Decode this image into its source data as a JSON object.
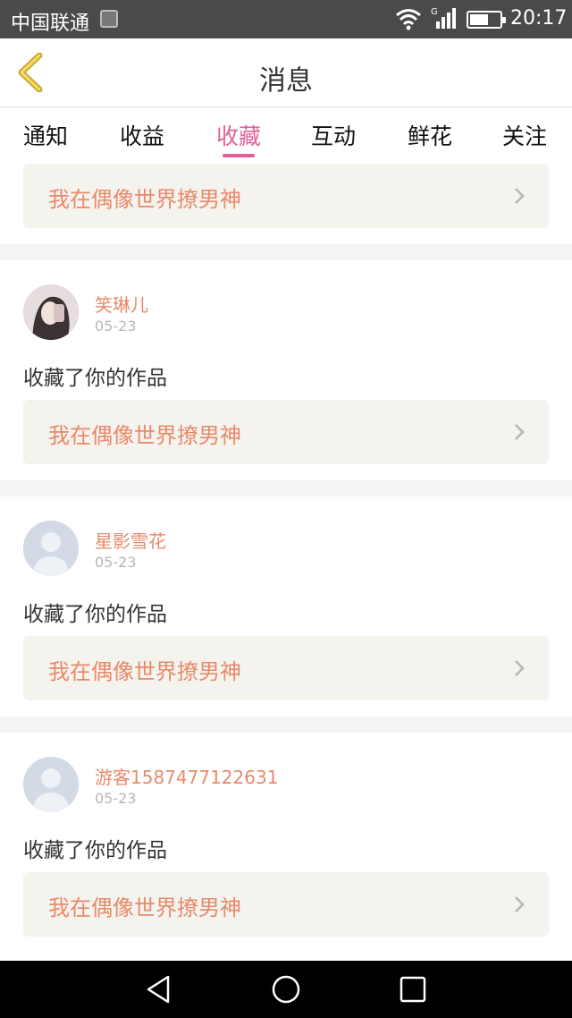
{
  "statusbar": {
    "carrier": "中国联通",
    "time": "20:17",
    "network": "G"
  },
  "header": {
    "title": "消息"
  },
  "tabs": [
    "通知",
    "收益",
    "收藏",
    "互动",
    "鲜花",
    "关注"
  ],
  "active_tab_index": 2,
  "top_link": "我在偶像世界撩男神",
  "items": [
    {
      "username": "笑琳儿",
      "date": "05-23",
      "action": "收藏了你的作品",
      "link": "我在偶像世界撩男神",
      "avatar": "photo"
    },
    {
      "username": "星影雪花",
      "date": "05-23",
      "action": "收藏了你的作品",
      "link": "我在偶像世界撩男神",
      "avatar": "default"
    },
    {
      "username": "游客1587477122631",
      "date": "05-23",
      "action": "收藏了你的作品",
      "link": "我在偶像世界撩男神",
      "avatar": "default"
    }
  ],
  "colors": {
    "accent": "#e2609a",
    "link": "#e8896a",
    "back_arrow": "#e8c840"
  }
}
